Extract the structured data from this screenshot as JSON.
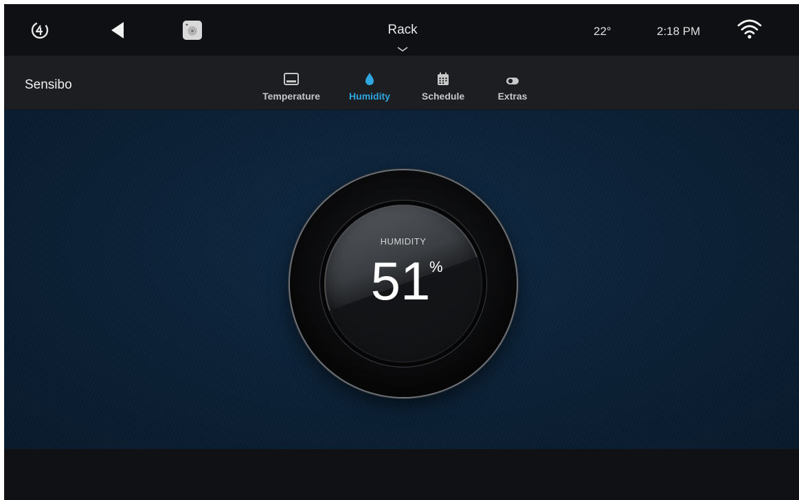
{
  "topbar": {
    "logo_icon": "c4-logo-icon",
    "back_icon": "back-arrow-icon",
    "device_icon": "device-thumbnail-icon",
    "room": "Rack",
    "temperature": "22°",
    "time": "2:18 PM",
    "wifi_icon": "wifi-icon"
  },
  "subbar": {
    "device_name": "Sensibo",
    "tabs": [
      {
        "label": "Temperature",
        "icon": "thermostat-icon",
        "active": false
      },
      {
        "label": "Humidity",
        "icon": "droplet-icon",
        "active": true
      },
      {
        "label": "Schedule",
        "icon": "calendar-icon",
        "active": false
      },
      {
        "label": "Extras",
        "icon": "toggle-icon",
        "active": false
      }
    ]
  },
  "dial": {
    "label": "HUMIDITY",
    "value": "51",
    "unit": "%"
  },
  "colors": {
    "accent": "#2fa6e0",
    "background": "#0c2238",
    "bar": "#1c1e21"
  }
}
